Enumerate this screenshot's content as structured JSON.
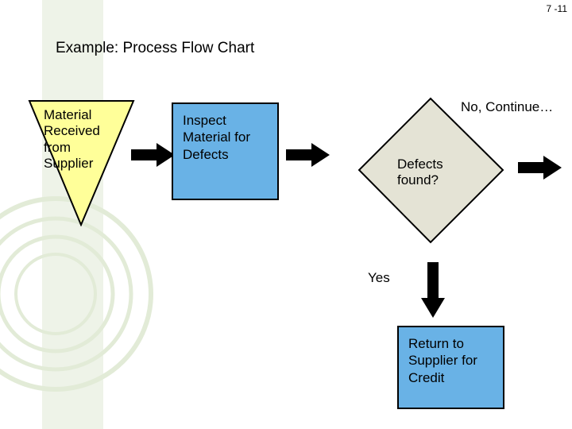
{
  "page_number": "7 -11",
  "title": "Example: Process Flow Chart",
  "flow": {
    "start": "Material Received from Supplier",
    "process1": "Inspect Material for Defects",
    "decision": "Defects found?",
    "no_label": "No, Continue…",
    "yes_label": "Yes",
    "process2": "Return to Supplier for Credit"
  },
  "colors": {
    "process_fill": "#69b2e6",
    "decision_fill": "#e4e3d5",
    "start_fill": "#ffff99",
    "deco_band": "#eef3e8",
    "ring": "#e2ebd7"
  },
  "chart_data": {
    "type": "table",
    "title": "Process Flow Chart – node/edge listing",
    "nodes": [
      {
        "id": "start",
        "shape": "inverted-triangle",
        "text": "Material Received from Supplier"
      },
      {
        "id": "inspect",
        "shape": "rectangle",
        "text": "Inspect Material for Defects"
      },
      {
        "id": "defects",
        "shape": "diamond",
        "text": "Defects found?"
      },
      {
        "id": "return",
        "shape": "rectangle",
        "text": "Return to Supplier for Credit"
      },
      {
        "id": "continue",
        "shape": "exit",
        "text": "No, Continue…"
      }
    ],
    "edges": [
      {
        "from": "start",
        "to": "inspect",
        "label": ""
      },
      {
        "from": "inspect",
        "to": "defects",
        "label": ""
      },
      {
        "from": "defects",
        "to": "continue",
        "label": "No"
      },
      {
        "from": "defects",
        "to": "return",
        "label": "Yes"
      }
    ]
  }
}
